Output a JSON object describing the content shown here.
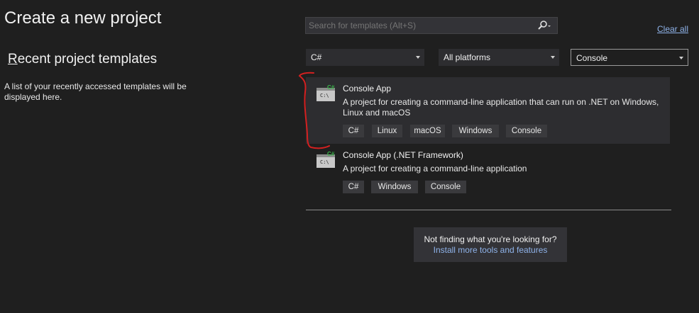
{
  "page": {
    "title": "Create a new project",
    "recent_title": "Recent project templates",
    "recent_desc": "A list of your recently accessed templates will be displayed here."
  },
  "search": {
    "placeholder": "Search for templates (Alt+S)",
    "clear_all": "Clear all"
  },
  "filters": {
    "language": "C#",
    "platform": "All platforms",
    "project_type": "Console"
  },
  "templates": [
    {
      "name": "Console App",
      "desc_line1": "A project for creating a command-line application that can run on .NET on Windows,",
      "desc_line2": "Linux and macOS",
      "icon_badge": "C#",
      "icon_text": "C:\\",
      "tags": [
        "C#",
        "Linux",
        "macOS",
        "Windows",
        "Console"
      ],
      "selected": true
    },
    {
      "name": "Console App (.NET Framework)",
      "desc_line1": "A project for creating a command-line application",
      "icon_badge": "C#",
      "icon_text": "C:\\",
      "tags": [
        "C#",
        "Windows",
        "Console"
      ],
      "selected": false
    }
  ],
  "not_finding": {
    "question": "Not finding what you're looking for?",
    "link": "Install more tools and features"
  },
  "colors": {
    "background": "#1f1f1f",
    "selected_bg": "#2d2d30",
    "link": "#8fb3ea",
    "badge_green": "#3ab54a",
    "annotation_red": "#d42020"
  }
}
